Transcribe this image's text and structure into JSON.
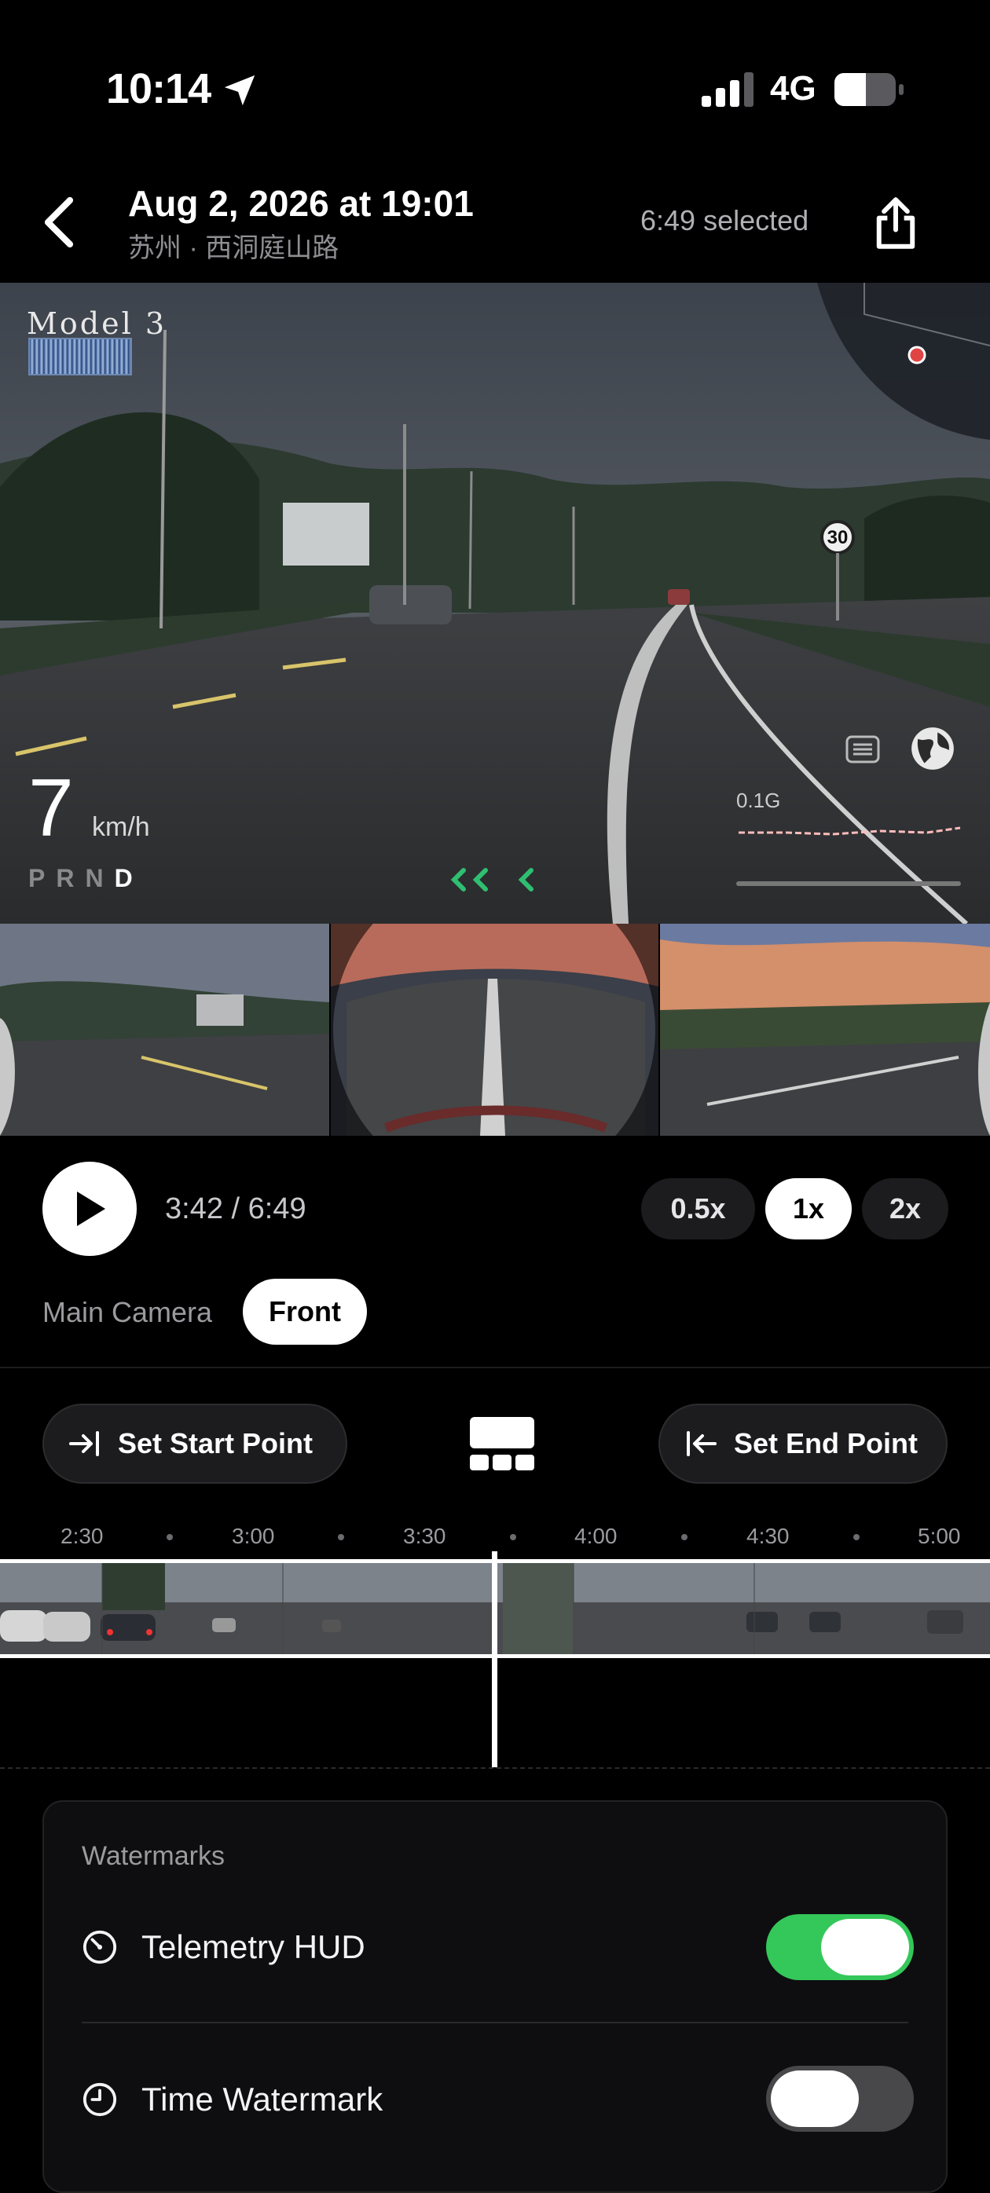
{
  "status_bar": {
    "time": "10:14",
    "carrier": "4G"
  },
  "header": {
    "title": "Aug 2, 2026 at 19:01",
    "subtitle": "苏州 · 西洞庭山路",
    "selected": "6:49 selected"
  },
  "hud": {
    "model": "Model 3",
    "speed": "7",
    "speed_unit": "km/h",
    "gears": [
      "P",
      "R",
      "N",
      "D"
    ],
    "active_gear": "D",
    "g_force": "0.1G",
    "speed_limit": "30"
  },
  "player": {
    "timecode": "3:42 / 6:49",
    "speeds": [
      "0.5x",
      "1x",
      "2x"
    ],
    "active_speed": "1x",
    "main_camera_label": "Main Camera",
    "main_camera_value": "Front"
  },
  "trim": {
    "start_label": "Set Start Point",
    "end_label": "Set End Point"
  },
  "timeline": {
    "ticks": [
      "2:30",
      "3:00",
      "3:30",
      "4:00",
      "4:30",
      "5:00"
    ]
  },
  "watermarks": {
    "title": "Watermarks",
    "items": [
      {
        "label": "Telemetry HUD",
        "enabled": true,
        "icon": "gauge-icon"
      },
      {
        "label": "Time Watermark",
        "enabled": false,
        "icon": "clock-icon"
      }
    ]
  },
  "colors": {
    "toggle_on": "#34c759",
    "toggle_off": "#48484a",
    "accent_green": "#2fbf71"
  }
}
